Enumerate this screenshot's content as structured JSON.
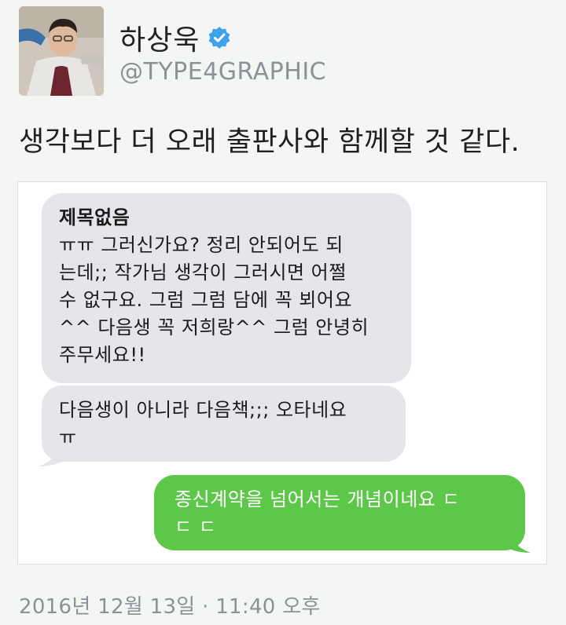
{
  "user": {
    "name": "하상욱",
    "handle": "@TYPE4GRAPHIC",
    "verified_icon": "verified-badge-icon"
  },
  "tweet": {
    "text": "생각보다 더 오래 출판사와 함께할 것 같다.",
    "timestamp": "2016년 12월 13일 · 11:40 오후"
  },
  "messages": [
    {
      "side": "received",
      "title": "제목없음",
      "lines": [
        "ㅠㅠ 그러신가요? 정리 안되어도 되",
        "는데;; 작가님 생각이 그러시면 어쩔",
        "수 없구요. 그럼 그럼 담에 꼭 뵈어요",
        "^^ 다음생 꼭 저희랑^^ 그럼 안녕히",
        "주무세요!!"
      ]
    },
    {
      "side": "received",
      "lines": [
        "다음생이 아니라 다음책;;; 오타네요",
        "ㅠ"
      ]
    },
    {
      "side": "sent",
      "lines": [
        "종신계약을 넘어서는 개념이네요 ㄷ",
        "ㄷ ㄷ"
      ]
    }
  ],
  "colors": {
    "background": "#f4f6f3",
    "received_bubble": "#e5e5ea",
    "sent_bubble": "#5dc749",
    "verified": "#3ea1ec",
    "muted_text": "#8a9298"
  }
}
